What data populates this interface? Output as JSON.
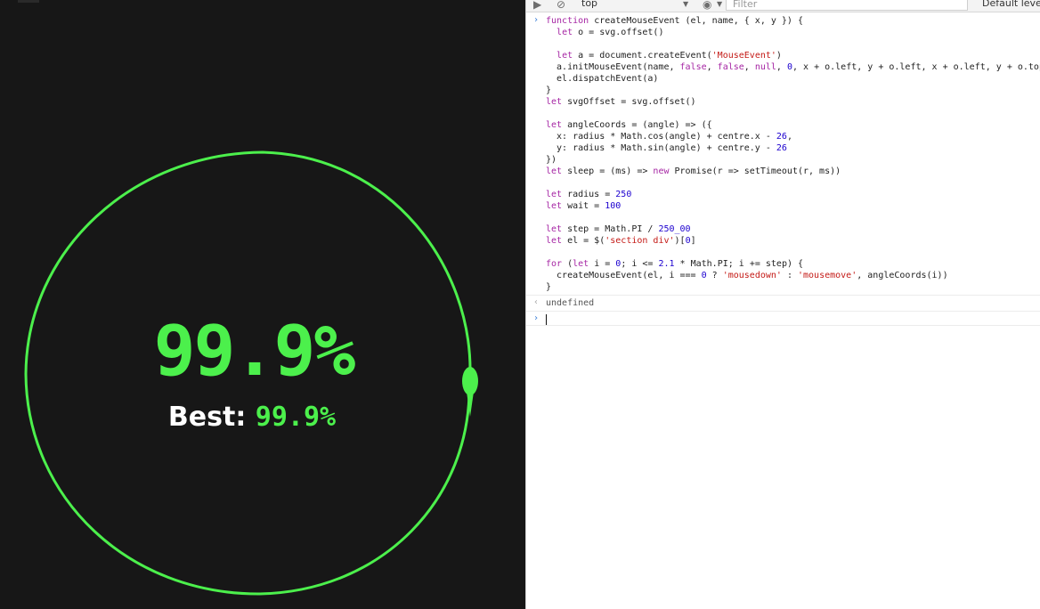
{
  "game": {
    "score": "99.9%",
    "best_label": "Best:",
    "best_value": "99.9%",
    "colors": {
      "accent": "#4cf04c",
      "background": "#171717",
      "text": "#ffffff"
    }
  },
  "devtools": {
    "context": "top",
    "filter_placeholder": "Filter",
    "levels_label": "Default levels",
    "icons": [
      "play-icon",
      "no-entry-icon",
      "eye-icon"
    ],
    "code_lines": [
      "function createMouseEvent (el, name, { x, y }) {",
      "  let o = svg.offset()",
      "",
      "  let a = document.createEvent('MouseEvent')",
      "  a.initMouseEvent(name, false, false, null, 0, x + o.left, y + o.left, x + o.left, y + o.top,",
      "  el.dispatchEvent(a)",
      "}",
      "let svgOffset = svg.offset()",
      "",
      "let angleCoords = (angle) => ({",
      "  x: radius * Math.cos(angle) + centre.x - 26,",
      "  y: radius * Math.sin(angle) + centre.y - 26",
      "})",
      "let sleep = (ms) => new Promise(r => setTimeout(r, ms))",
      "",
      "let radius = 250",
      "let wait = 100",
      "",
      "let step = Math.PI / 250_00",
      "let el = $('section div')[0]",
      "",
      "for (let i = 0; i <= 2.1 * Math.PI; i += step) {",
      "  createMouseEvent(el, i === 0 ? 'mousedown' : 'mousemove', angleCoords(i))",
      "}"
    ],
    "result": "undefined"
  }
}
